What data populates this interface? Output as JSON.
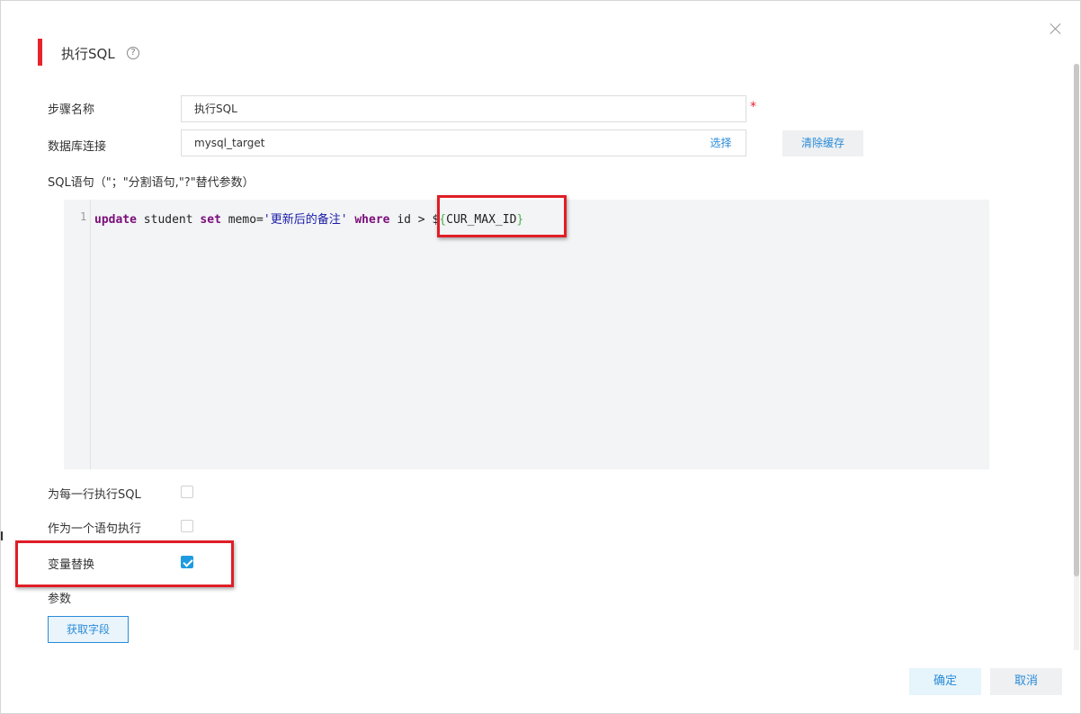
{
  "dialog": {
    "title": "执行SQL",
    "help_icon": "question-circle-icon",
    "close_icon": "close-icon"
  },
  "form": {
    "step_name_label": "步骤名称",
    "step_name_value": "执行SQL",
    "required_mark": "*",
    "db_conn_label": "数据库连接",
    "db_conn_value": "mysql_target",
    "select_button": "选择",
    "clear_cache_button": "清除缓存",
    "sql_label": "SQL语句（\"；\"分割语句,\"?\"替代参数）"
  },
  "editor": {
    "line_number": "1",
    "tokens": {
      "kw_update": "update",
      "t1": " student ",
      "kw_set": "set",
      "t2": " memo=",
      "str_memo": "'更新后的备注'",
      "t3": " ",
      "kw_where": "where",
      "t4": " id > $",
      "brace_open": "{",
      "var": "CUR_MAX_ID",
      "brace_close": "}"
    }
  },
  "options": {
    "exec_each_row_label": "为每一行执行SQL",
    "exec_each_row_checked": false,
    "exec_as_single_label": "作为一个语句执行",
    "exec_as_single_checked": false,
    "var_replace_label": "变量替换",
    "var_replace_checked": true,
    "params_label": "参数",
    "get_fields_button": "获取字段"
  },
  "footer": {
    "ok_button": "确定",
    "cancel_button": "取消"
  },
  "colors": {
    "accent_red": "#e8232b",
    "link_blue": "#2a8bd8",
    "checkbox_blue": "#1e9be0",
    "editor_bg": "#f3f4f6"
  }
}
